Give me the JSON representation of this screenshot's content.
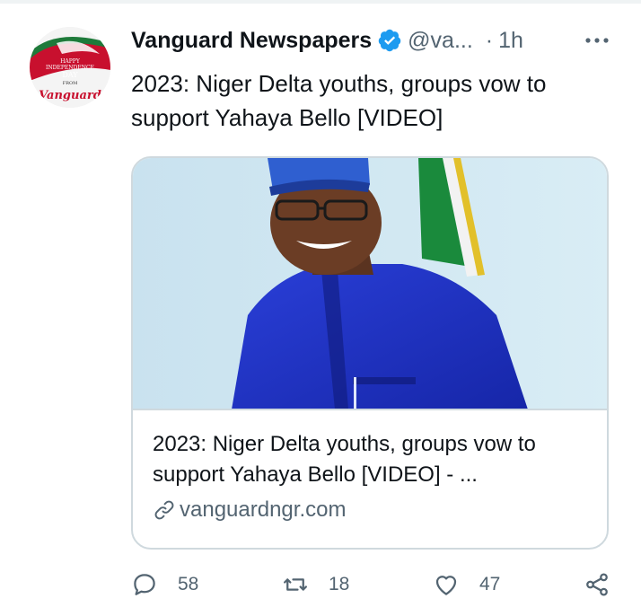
{
  "tweet": {
    "author_name": "Vanguard Newspapers",
    "handle": "@va...",
    "separator": "·",
    "time": "1h",
    "text": "2023: Niger Delta youths, groups vow to support Yahaya Bello [VIDEO]",
    "avatar": {
      "lines": [
        "HAPPY",
        "INDEPENDENCE",
        "DAY",
        "FROM",
        "Vanguard"
      ]
    }
  },
  "card": {
    "title": "2023: Niger Delta youths, groups vow to support Yahaya Bello [VIDEO] - ...",
    "domain": "vanguardngr.com"
  },
  "actions": {
    "replies": "58",
    "retweets": "18",
    "likes": "47"
  },
  "colors": {
    "text": "#0f1419",
    "secondary": "#536471",
    "border": "#cfd9de",
    "verified": "#1d9bf0"
  }
}
